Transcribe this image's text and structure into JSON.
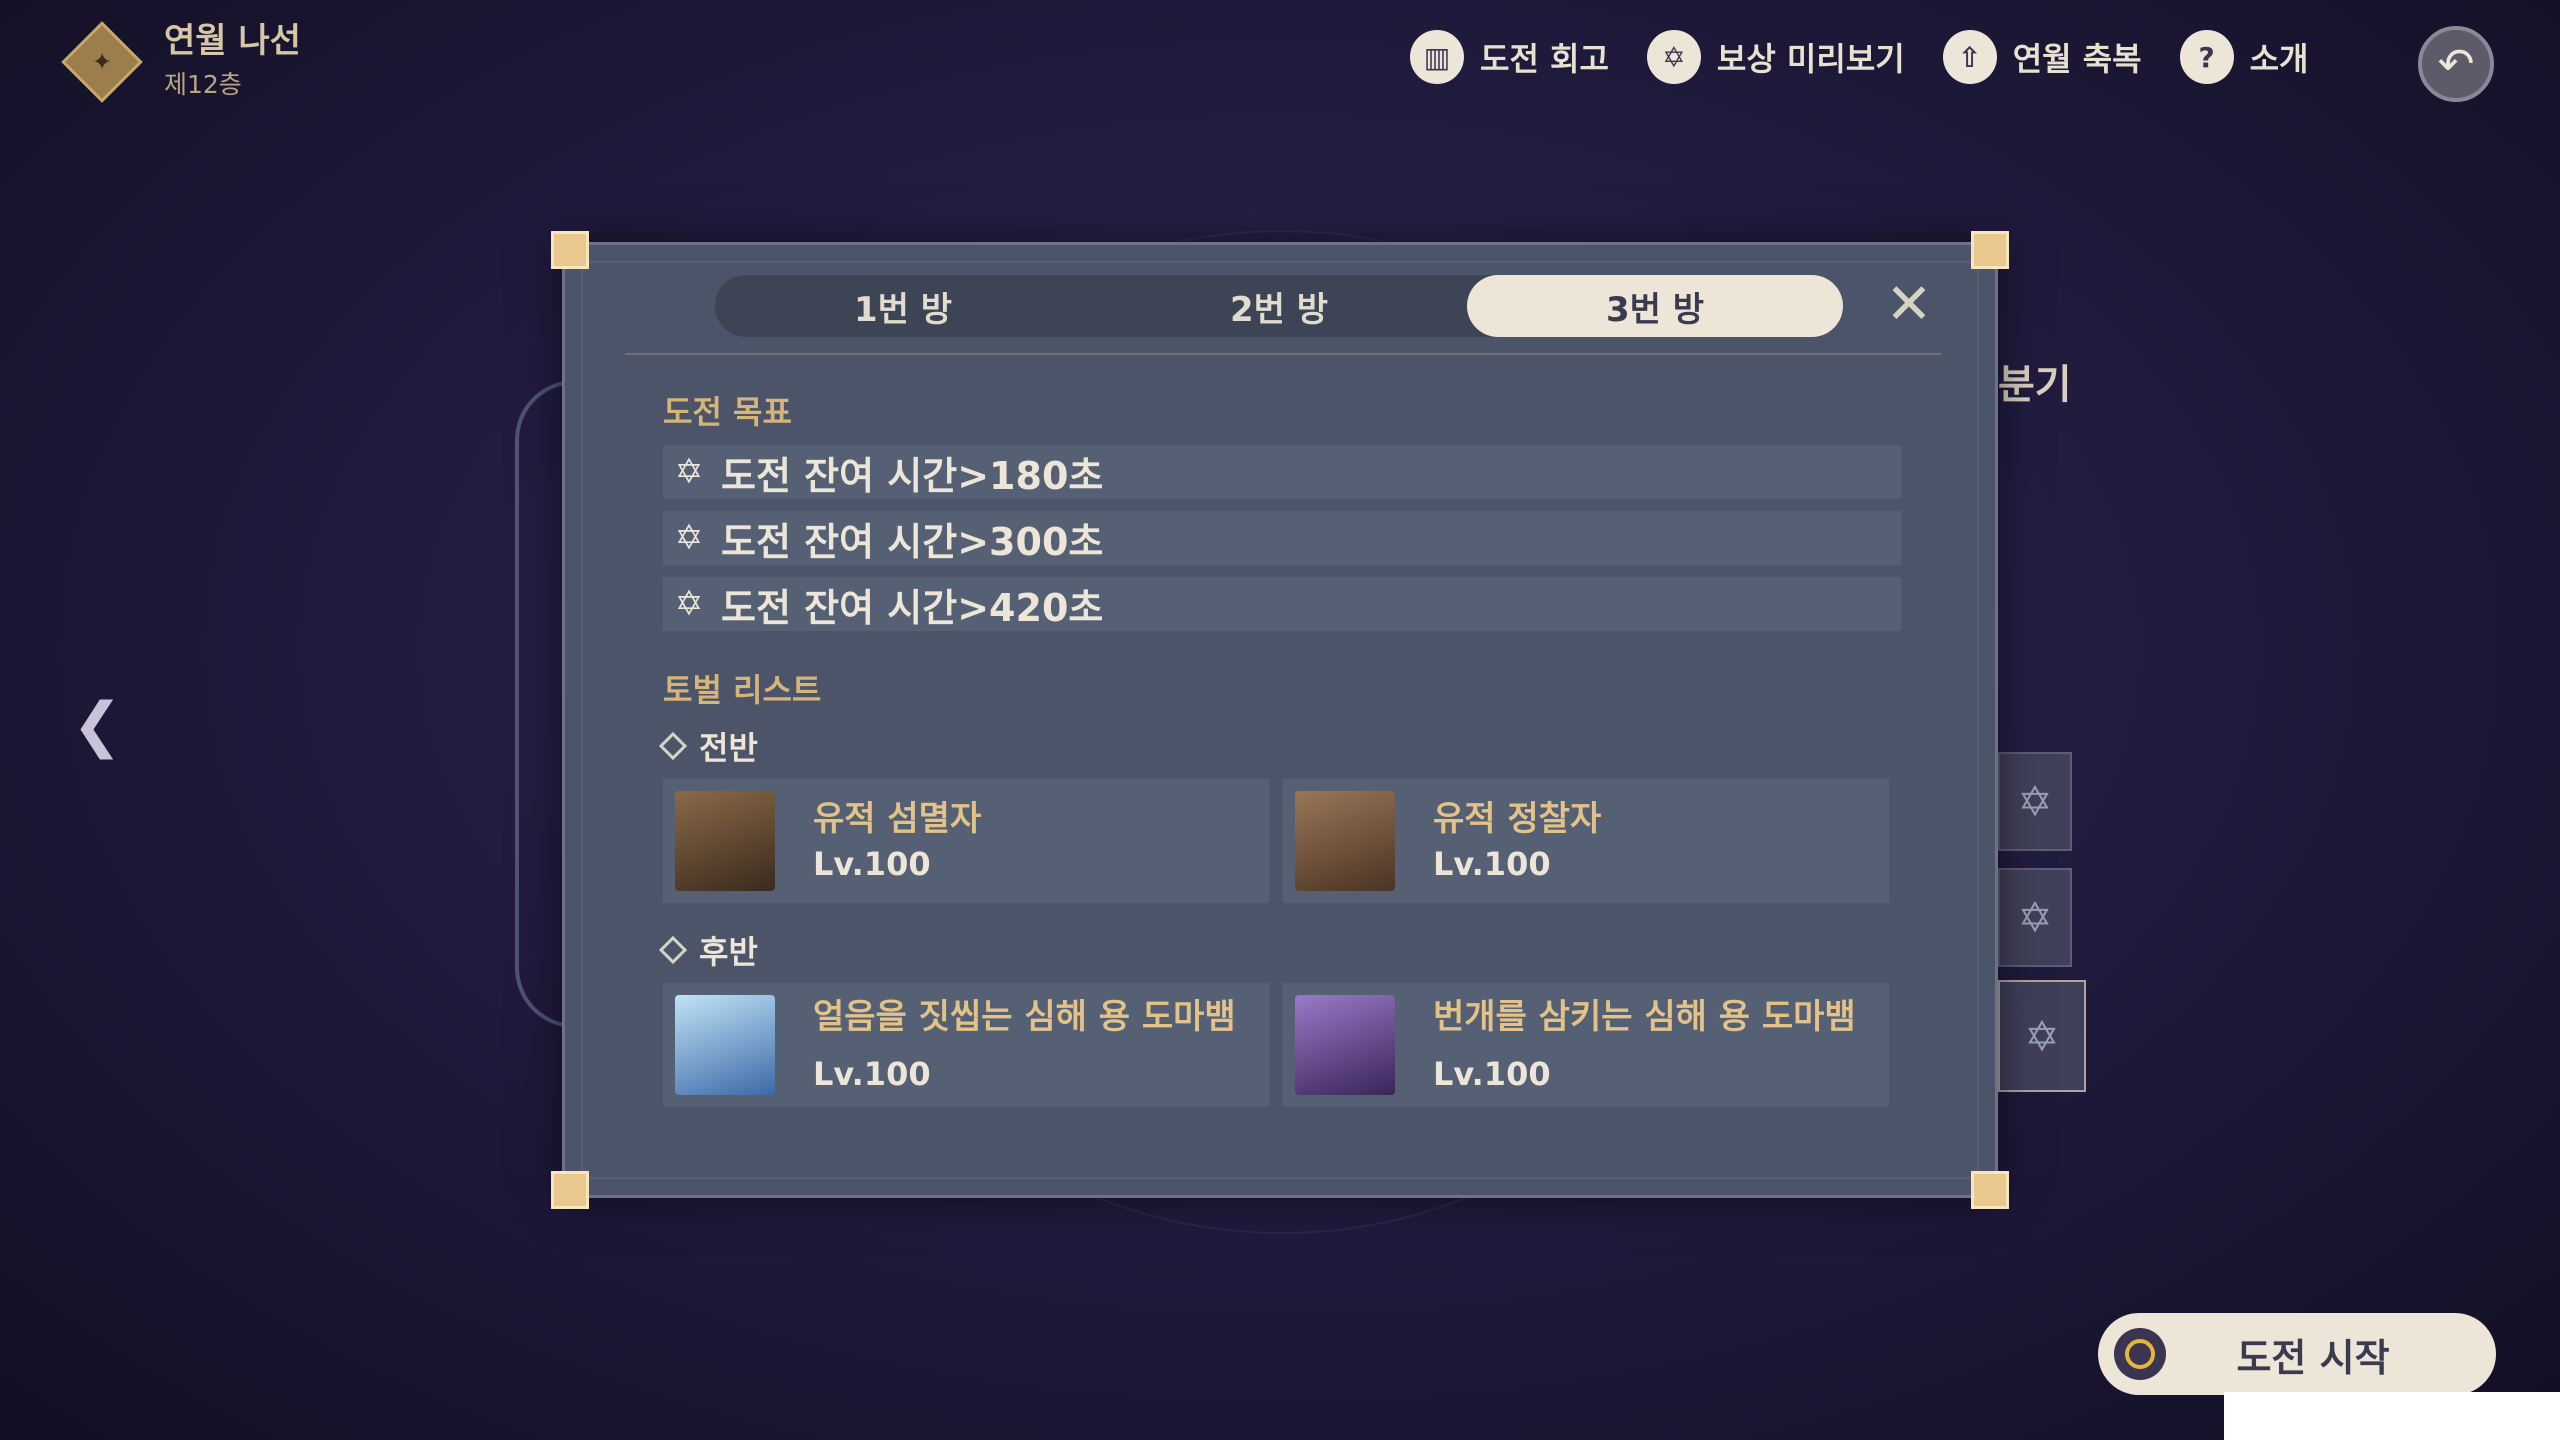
{
  "header": {
    "title": "연월 나선",
    "floor": "제12층"
  },
  "top_menu": [
    {
      "label": "도전 회고",
      "icon": "book-icon"
    },
    {
      "label": "보상 미리보기",
      "icon": "reward-icon"
    },
    {
      "label": "연월 축복",
      "icon": "blessing-icon"
    },
    {
      "label": "소개",
      "icon": "help-icon"
    }
  ],
  "background": {
    "tab_label": "분기"
  },
  "modal": {
    "tabs": [
      {
        "label": "1번 방",
        "active": false
      },
      {
        "label": "2번 방",
        "active": false
      },
      {
        "label": "3번 방",
        "active": true
      }
    ],
    "goals_title": "도전 목표",
    "goals": [
      "도전 잔여 시간>180초",
      "도전 잔여 시간>300초",
      "도전 잔여 시간>420초"
    ],
    "enemies_title": "토벌 리스트",
    "halves": [
      {
        "label": "전반",
        "enemies": [
          {
            "name": "유적 섬멸자",
            "level": "Lv.100"
          },
          {
            "name": "유적 정찰자",
            "level": "Lv.100"
          }
        ]
      },
      {
        "label": "후반",
        "enemies": [
          {
            "name": "얼음을 짓씹는 심해 용 도마뱀",
            "level": "Lv.100"
          },
          {
            "name": "번개를 삼키는 심해 용 도마뱀",
            "level": "Lv.100"
          }
        ]
      }
    ]
  },
  "start_button": {
    "label": "도전 시작"
  }
}
